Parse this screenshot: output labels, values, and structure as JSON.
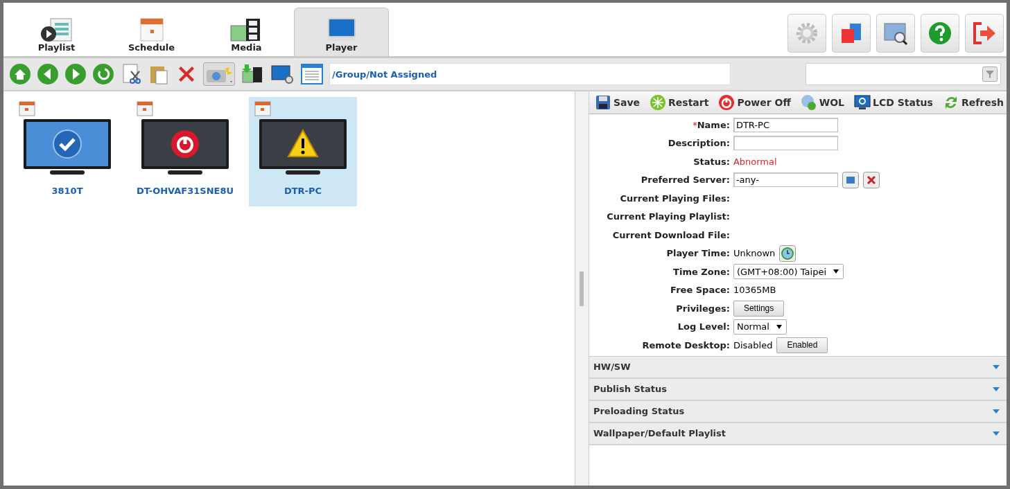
{
  "tabs": [
    {
      "label": "Playlist",
      "kind": "playlist",
      "selected": false
    },
    {
      "label": "Schedule",
      "kind": "schedule",
      "selected": false
    },
    {
      "label": "Media",
      "kind": "media",
      "selected": false
    },
    {
      "label": "Player",
      "kind": "player",
      "selected": true
    }
  ],
  "path": "/Group/Not Assigned",
  "players": [
    {
      "name": "3810T",
      "kind": "ok",
      "selected": false
    },
    {
      "name": "DT-OHVAF31SNE8U",
      "kind": "off",
      "selected": false
    },
    {
      "name": "DTR-PC",
      "kind": "warning",
      "selected": true
    }
  ],
  "actions": [
    {
      "label": "Save",
      "kind": "save"
    },
    {
      "label": "Restart",
      "kind": "restart"
    },
    {
      "label": "Power Off",
      "kind": "power"
    },
    {
      "label": "WOL",
      "kind": "wol"
    },
    {
      "label": "LCD Status",
      "kind": "lcd"
    },
    {
      "label": "Refresh",
      "kind": "refresh"
    }
  ],
  "form": [
    {
      "label": "Name:",
      "required_mark": "*",
      "kind": "input",
      "value": "DTR-PC"
    },
    {
      "label": "Description:",
      "kind": "input"
    },
    {
      "label": "Status:",
      "kind": "status",
      "value": "Abnormal"
    },
    {
      "label": "Preferred Server:",
      "kind": "server",
      "value": "-any-"
    },
    {
      "label": "Current Playing Files:",
      "kind": "empty"
    },
    {
      "label": "Current Playing Playlist:",
      "kind": "empty"
    },
    {
      "label": "Current Download File:",
      "kind": "empty"
    },
    {
      "label": "Player Time:",
      "kind": "time",
      "value": "Unknown"
    },
    {
      "label": "Time Zone:",
      "kind": "select",
      "value": "(GMT+08:00) Taipei"
    },
    {
      "label": "Free Space:",
      "kind": "text",
      "value": "10365MB"
    },
    {
      "label": "Privileges:",
      "kind": "button",
      "button": "Settings"
    },
    {
      "label": "Log Level:",
      "kind": "select",
      "value": "Normal"
    },
    {
      "label": "Remote Desktop:",
      "kind": "toggle",
      "value": "Disabled",
      "button": "Enabled"
    }
  ],
  "sections": [
    {
      "label": "HW/SW"
    },
    {
      "label": "Publish Status"
    },
    {
      "label": "Preloading Status"
    },
    {
      "label": "Wallpaper/Default Playlist"
    }
  ]
}
